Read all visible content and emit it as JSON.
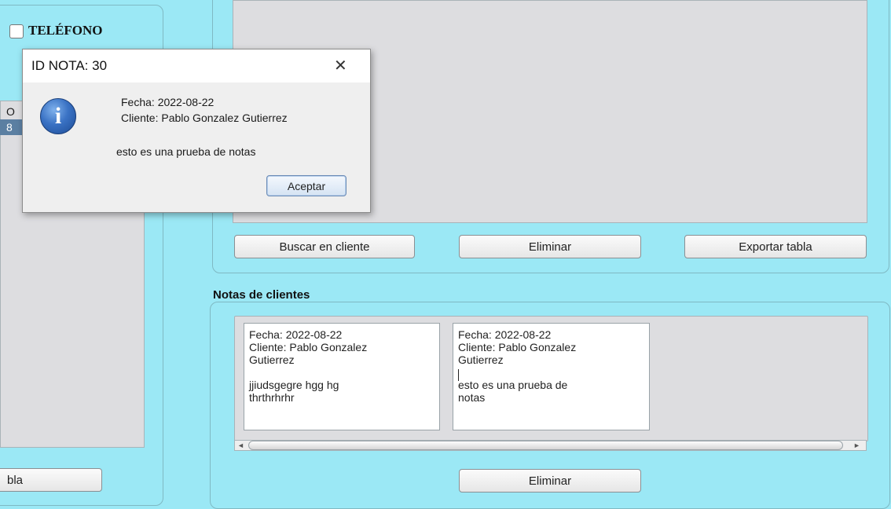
{
  "left_panel": {
    "checkbox_label": "TELÉFONO",
    "list_item_1": "O",
    "list_item_2": "8",
    "button_label": "bla"
  },
  "top_panel": {
    "buttons": {
      "search_client": "Buscar en cliente",
      "delete": "Eliminar",
      "export_table": "Exportar tabla"
    }
  },
  "notes_section": {
    "title": "Notas de clientes",
    "notes": [
      {
        "text": "Fecha: 2022-08-22\nCliente: Pablo Gonzalez\nGutierrez\n\njjiudsgegre hgg hg\nthrthrhrhr"
      },
      {
        "text": "Fecha: 2022-08-22\nCliente: Pablo Gonzalez\nGutierrez\n\nesto es una prueba de\nnotas"
      }
    ],
    "scroll_left": "◄",
    "scroll_right": "►",
    "delete_button": "Eliminar"
  },
  "dialog": {
    "title": "ID NOTA: 30",
    "close": "✕",
    "icon": "info-icon",
    "icon_glyph": "i",
    "line1": "Fecha: 2022-08-22",
    "line2": "Cliente: Pablo Gonzalez Gutierrez",
    "message": "esto es una prueba de notas",
    "ok_button": "Aceptar"
  },
  "colors": {
    "background": "#9be8f5",
    "table_area": "#dddde0",
    "dialog_info_icon": "#2c62b0"
  }
}
